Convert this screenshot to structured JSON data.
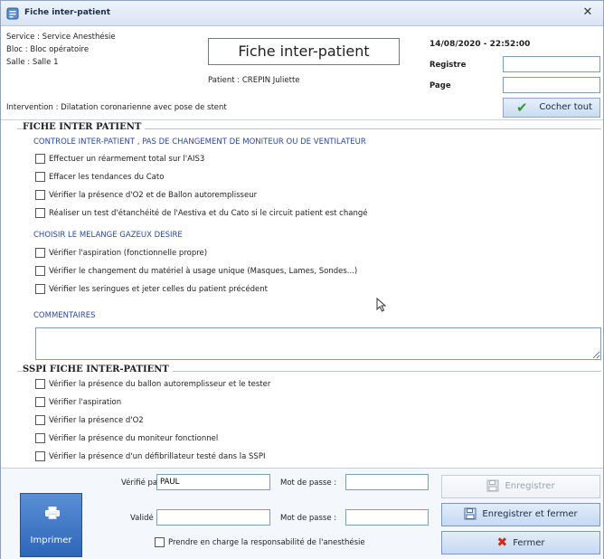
{
  "window": {
    "title": "Fiche inter-patient",
    "close_glyph": "✕"
  },
  "header": {
    "service": "Service : Service Anesthésie",
    "bloc": "Bloc : Bloc opératoire",
    "salle": "Salle : Salle 1",
    "intervention": "Intervention : Dilatation coronarienne avec pose de stent",
    "form_title": "Fiche inter-patient",
    "patient": "Patient : CREPIN Juliette",
    "datetime": "14/08/2020 - 22:52:00",
    "registre_label": "Registre",
    "registre_value": "",
    "page_label": "Page",
    "page_value": "",
    "cocher_tout_label": "Cocher tout"
  },
  "section1": {
    "title": "FICHE INTER PATIENT",
    "subtitle1": "CONTROLE INTER-PATIENT , PAS DE CHANGEMENT DE MONITEUR OU DE VENTILATEUR",
    "group1": [
      {
        "label": "Effectuer un réarmement total sur l'AIS3",
        "checked": false
      },
      {
        "label": "Effacer les tendances du Cato",
        "checked": false
      },
      {
        "label": "Vérifier la présence d'O2 et de Ballon autoremplisseur",
        "checked": false
      },
      {
        "label": "Réaliser un test d'étanchéité de l'Aestiva et du Cato si le circuit patient est changé",
        "checked": false
      }
    ],
    "subtitle2": "CHOISIR LE MELANGE GAZEUX DESIRE",
    "group2": [
      {
        "label": "Vérifier l'aspiration (fonctionnelle propre)",
        "checked": false
      },
      {
        "label": "Vérifier le changement du matériel à usage unique (Masques, Lames, Sondes...)",
        "checked": false
      },
      {
        "label": "Vérifier les seringues et jeter celles du patient précédent",
        "checked": false
      }
    ],
    "comments_label": "COMMENTAIRES",
    "comments_value": ""
  },
  "section2": {
    "title": "SSPI FICHE INTER-PATIENT",
    "items": [
      {
        "label": "Vérifier la présence du ballon autoremplisseur et le tester",
        "checked": false
      },
      {
        "label": "Vérifier l'aspiration",
        "checked": false
      },
      {
        "label": "Vérifier la présence d'O2",
        "checked": false
      },
      {
        "label": "Vérifier la présence du moniteur fonctionnel",
        "checked": false
      },
      {
        "label": "Vérifier la présence d'un défibrillateur testé dans la SSPI",
        "checked": false
      }
    ]
  },
  "bottom": {
    "print_label": "Imprimer",
    "verifie_par_label": "Vérifié par :",
    "verifie_par_value": "PAUL",
    "valide_par_label": "Validé par :",
    "valide_par_value": "",
    "mot_de_passe_label": "Mot de passe :",
    "mot_de_passe_1": "",
    "mot_de_passe_2": "",
    "responsabilite_label": "Prendre en charge la responsabilité de l'anesthésie",
    "enregistrer_label": "Enregistrer",
    "enregistrer_fermer_label": "Enregistrer et fermer",
    "fermer_label": "Fermer"
  }
}
